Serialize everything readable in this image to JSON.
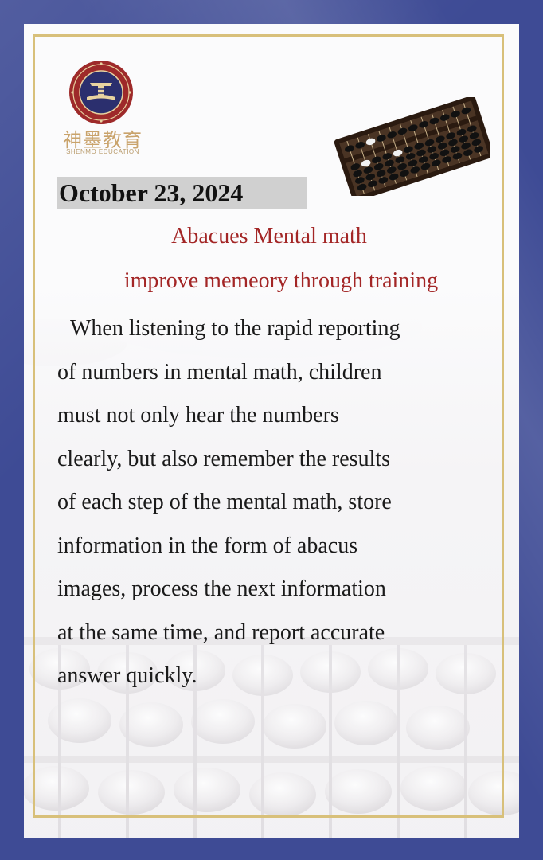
{
  "logo": {
    "name_cn": "神墨教育",
    "name_en": "SHENMO EDUCATION"
  },
  "date": "October 23, 2024",
  "headline": {
    "line1": "Abacues Mental math",
    "line2": "improve memeory through training"
  },
  "body_lines": [
    "When listening to the rapid reporting",
    "of numbers in mental math, children",
    "must not only hear the numbers",
    "clearly, but also remember the results",
    "of each step of the mental math, store",
    "information in the form of abacus",
    "images, process the next information",
    "at the same time, and report accurate",
    "answer quickly."
  ],
  "colors": {
    "frame_blue": "#3e4b95",
    "gold_border": "#d8c07a",
    "headline_red": "#a32626",
    "date_highlight": "#d0d0d0",
    "logo_gold": "#c9a36b",
    "seal_red": "#9e2a2a",
    "seal_navy": "#2b2f6e"
  }
}
